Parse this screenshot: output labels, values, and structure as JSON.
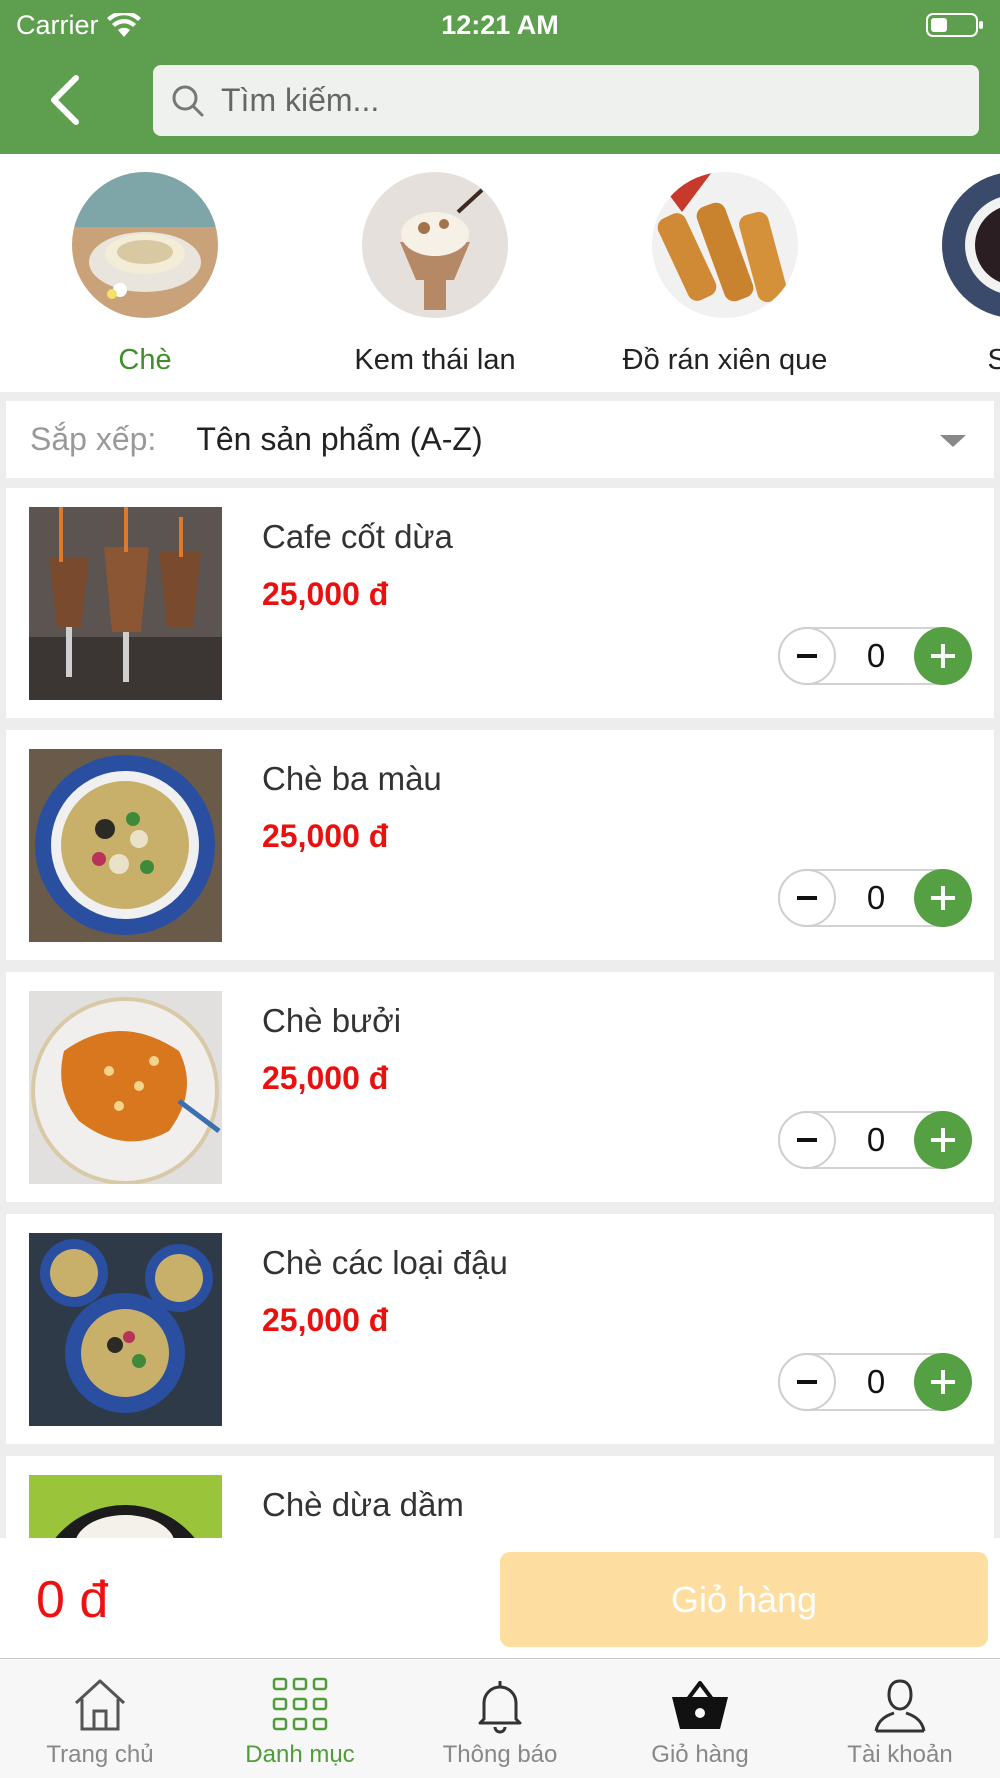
{
  "status_bar": {
    "carrier": "Carrier",
    "time": "12:21 AM"
  },
  "search": {
    "placeholder": "Tìm kiếm..."
  },
  "categories": [
    {
      "label": "Chè",
      "active": true
    },
    {
      "label": "Kem thái lan",
      "active": false
    },
    {
      "label": "Đồ rán xiên que",
      "active": false
    },
    {
      "label": "Sữa",
      "active": false
    }
  ],
  "sort": {
    "label": "Sắp xếp:",
    "value": "Tên sản phẩm (A-Z)"
  },
  "products": [
    {
      "name": "Cafe cốt dừa",
      "price": "25,000 đ",
      "qty": "0"
    },
    {
      "name": "Chè ba màu",
      "price": "25,000 đ",
      "qty": "0"
    },
    {
      "name": "Chè bưởi",
      "price": "25,000 đ",
      "qty": "0"
    },
    {
      "name": "Chè các loại đậu",
      "price": "25,000 đ",
      "qty": "0"
    },
    {
      "name": "Chè dừa dầm"
    }
  ],
  "cart": {
    "total": "0 đ",
    "button_label": "Giỏ hàng"
  },
  "tabs": [
    {
      "label": "Trang chủ",
      "icon": "home-icon"
    },
    {
      "label": "Danh mục",
      "icon": "grid-icon",
      "active": true
    },
    {
      "label": "Thông báo",
      "icon": "bell-icon"
    },
    {
      "label": "Giỏ hàng",
      "icon": "basket-icon"
    },
    {
      "label": "Tài khoản",
      "icon": "user-icon"
    }
  ],
  "colors": {
    "header": "#5e9e4f",
    "price": "#e8110f",
    "active_tab": "#4f9c39",
    "cart_button": "#fddea0"
  }
}
